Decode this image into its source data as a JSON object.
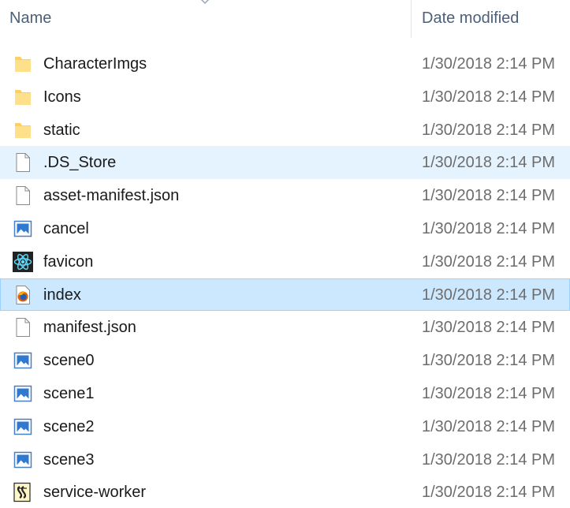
{
  "header": {
    "name_label": "Name",
    "date_label": "Date modified"
  },
  "files": [
    {
      "name": "CharacterImgs",
      "date": "1/30/2018 2:14 PM",
      "icon": "folder-icon",
      "state": "normal"
    },
    {
      "name": "Icons",
      "date": "1/30/2018 2:14 PM",
      "icon": "folder-icon",
      "state": "normal"
    },
    {
      "name": "static",
      "date": "1/30/2018 2:14 PM",
      "icon": "folder-icon",
      "state": "normal"
    },
    {
      "name": ".DS_Store",
      "date": "1/30/2018 2:14 PM",
      "icon": "blank-file-icon",
      "state": "hover"
    },
    {
      "name": "asset-manifest.json",
      "date": "1/30/2018 2:14 PM",
      "icon": "blank-file-icon",
      "state": "normal"
    },
    {
      "name": "cancel",
      "date": "1/30/2018 2:14 PM",
      "icon": "image-file-icon",
      "state": "normal"
    },
    {
      "name": "favicon",
      "date": "1/30/2018 2:14 PM",
      "icon": "react-atom-icon",
      "state": "normal"
    },
    {
      "name": "index",
      "date": "1/30/2018 2:14 PM",
      "icon": "firefox-html-icon",
      "state": "selected"
    },
    {
      "name": "manifest.json",
      "date": "1/30/2018 2:14 PM",
      "icon": "blank-file-icon",
      "state": "normal"
    },
    {
      "name": "scene0",
      "date": "1/30/2018 2:14 PM",
      "icon": "image-file-icon",
      "state": "normal"
    },
    {
      "name": "scene1",
      "date": "1/30/2018 2:14 PM",
      "icon": "image-file-icon",
      "state": "normal"
    },
    {
      "name": "scene2",
      "date": "1/30/2018 2:14 PM",
      "icon": "image-file-icon",
      "state": "normal"
    },
    {
      "name": "scene3",
      "date": "1/30/2018 2:14 PM",
      "icon": "image-file-icon",
      "state": "normal"
    },
    {
      "name": "service-worker",
      "date": "1/30/2018 2:14 PM",
      "icon": "script-file-icon",
      "state": "normal"
    }
  ],
  "colors": {
    "header_text": "#4c607a",
    "hover_bg": "#e5f3ff",
    "selected_bg": "#cce8ff",
    "selected_border": "#99d1ff",
    "folder": "#ffd15c"
  }
}
